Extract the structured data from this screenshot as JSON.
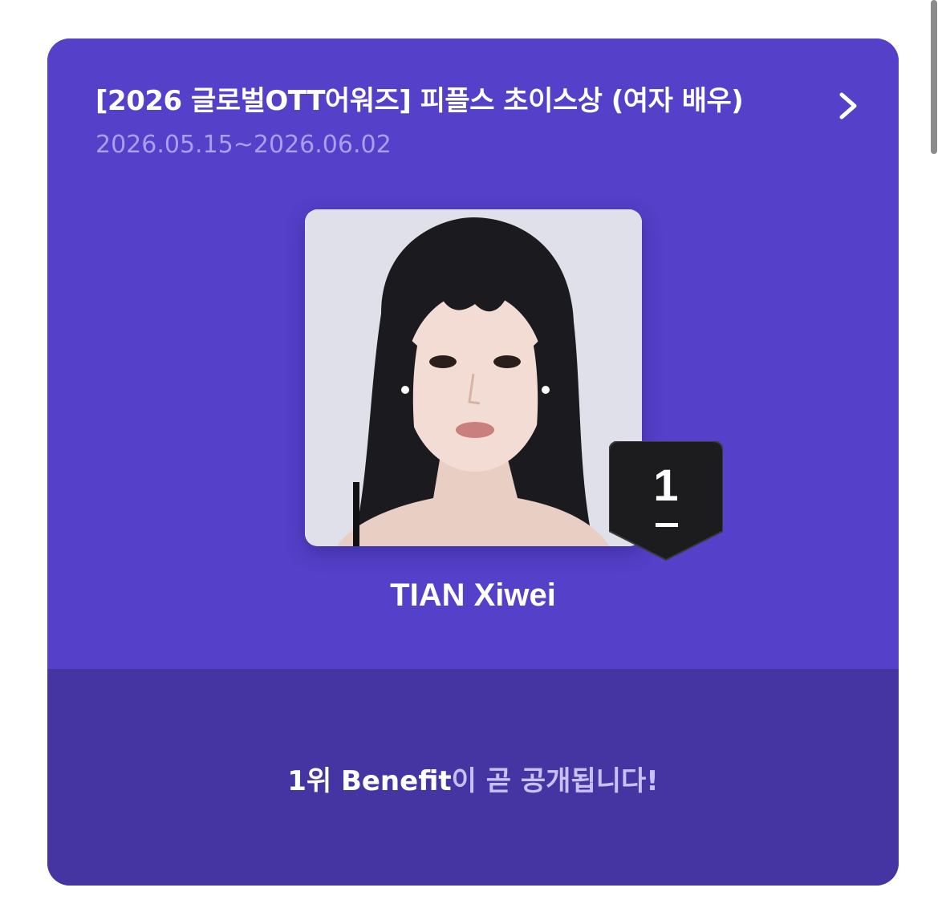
{
  "vote": {
    "title": "[2026 글로벌OTT어워즈] 피플스 초이스상 (여자 배우)",
    "period": "2026.05.15~2026.06.02",
    "more_icon": "chevron-right-icon"
  },
  "leader": {
    "rank": "1",
    "rank_change": "—",
    "name": "TIAN Xiwei",
    "photo": "portrait of a woman with long dark hair and bangs, light grey background"
  },
  "benefit": {
    "highlight": "1위 Benefit",
    "rest": "이 곧 공개됩니다!"
  },
  "colors": {
    "card_primary": "#5440c9",
    "card_secondary": "#4535a3",
    "date_text": "#a99ef0",
    "badge": "#1c1c1e"
  }
}
